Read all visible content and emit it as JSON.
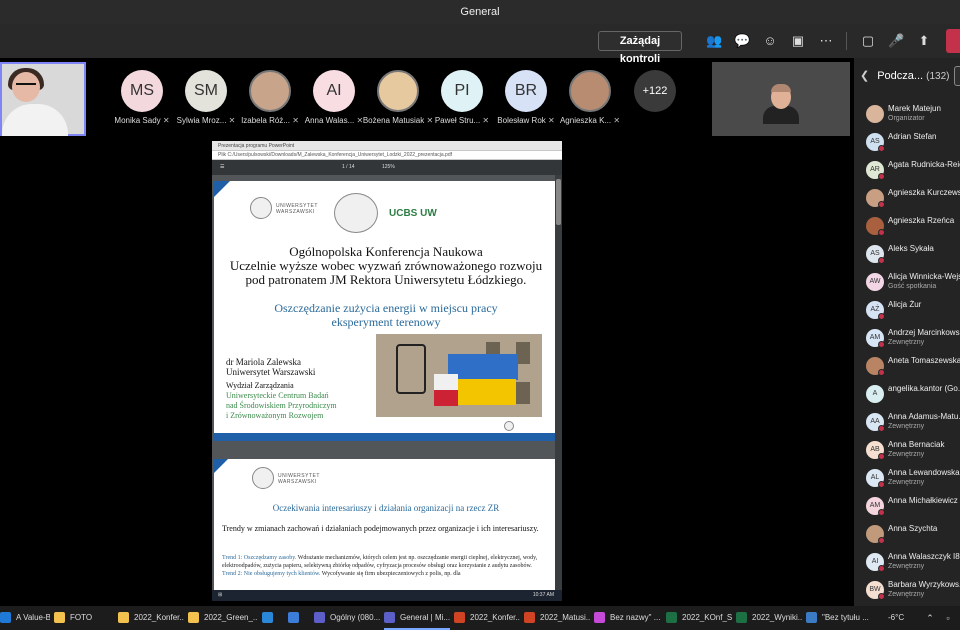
{
  "window": {
    "title": "General"
  },
  "toolbar": {
    "request_control_label": "Zażądaj kontroli",
    "icons": [
      "people-icon",
      "chat-icon",
      "reactions-icon",
      "rooms-icon",
      "more-icon",
      "camera-off-icon",
      "mic-off-icon",
      "share-icon",
      "leave-icon"
    ]
  },
  "participants": [
    {
      "initials": "MS",
      "name": "Monika Sady",
      "color": "#f3d9dd"
    },
    {
      "initials": "SM",
      "name": "Sylwia Mroz...",
      "color": "#e3e3dc"
    },
    {
      "initials": "",
      "name": "Izabela Róż...",
      "color": "#c8a48a",
      "photo": true
    },
    {
      "initials": "AI",
      "name": "Anna Walas...",
      "color": "#f8dde3"
    },
    {
      "initials": "",
      "name": "Bożena Matusiak",
      "color": "#e7c9a0",
      "photo": true
    },
    {
      "initials": "PI",
      "name": "Paweł Stru...",
      "color": "#dff2f5"
    },
    {
      "initials": "BR",
      "name": "Bolesław Rok",
      "color": "#d7e2f7"
    },
    {
      "initials": "",
      "name": "Agnieszka K...",
      "color": "#b88c70",
      "photo": true
    }
  ],
  "more_participants": "+122",
  "share": {
    "tab_text": "Prezentacja programu PowerPoint",
    "url_text": "Plik  C:/Users/pulsowski/Downloads/M_Zalewska_Konferencja_Uniwersytet_Lodzki_2022_prezentacja.pdf",
    "page_indicator": "1 / 14",
    "zoom": "125%",
    "slide1": {
      "university_name": "UNIWERSYTET WARSZAWSKI",
      "center_abbr": "UCBS UW",
      "title_lines": [
        "Ogólnopolska Konferencja Naukowa",
        "Uczelnie wyższe wobec wyzwań zrównoważonego rozwoju",
        "pod patronatem JM Rektora Uniwersytetu Łódzkiego."
      ],
      "subtitle_lines": [
        "Oszczędzanie zużycia energii w miejscu pracy",
        "eksperyment terenowy"
      ],
      "author_lines": [
        "dr Mariola Zalewska",
        "Uniwersytet Warszawski"
      ],
      "department": "Wydział Zarządzania",
      "center_lines": [
        "Uniwersyteckie Centrum Badań",
        "nad Środowiskiem Przyrodniczym",
        "i Zrównoważonym Rozwojem"
      ]
    },
    "slide2": {
      "university_name": "UNIWERSYTET WARSZAWSKI",
      "title": "Oczekiwania interesariuszy i działania organizacji na rzecz ZR",
      "trend_intro": "Trendy w zmianach zachowań i działaniach podejmowanych przez organizacje i ich interesariuszy.",
      "trend1_label": "Trend 1: Oszczędzamy zasoby.",
      "trend1_text": " Wdrażanie mechanizmów, których celem jest np. oszczędzanie energii cieplnej, elektrycznej, wody, elektroodpadów, zużycia papieru, selektywną zbiórkę odpadów, cyfryzacja procesów obsługi oraz korzystanie z audytu zasobów.",
      "trend2_label": "Trend 2: Nie obsługujemy tych klientów.",
      "trend2_text": " Wycofywanie się firm ubezpieczeniowych z polis, np. dla"
    },
    "taskbar_time": "10:37 AM"
  },
  "sidebar": {
    "title": "Podcza...",
    "count": "(132)",
    "button": "Wy",
    "people": [
      {
        "name": "Marek Matejun",
        "role": "Organizator",
        "initials": "",
        "color": "#d9b59b",
        "status": "none"
      },
      {
        "name": "Adrian Stefan",
        "role": "",
        "initials": "AS",
        "color": "#cfe0f0",
        "status": "red"
      },
      {
        "name": "Agata Rudnicka-Reich",
        "role": "",
        "initials": "AR",
        "color": "#dfe8d5",
        "status": "red"
      },
      {
        "name": "Agnieszka Kurczewska",
        "role": "",
        "initials": "",
        "color": "#c89f82",
        "status": "red"
      },
      {
        "name": "Agnieszka Rzeńca",
        "role": "",
        "initials": "",
        "color": "#a8603f",
        "status": "red"
      },
      {
        "name": "Aleks Sykała",
        "role": "",
        "initials": "AS",
        "color": "#dde6ee",
        "status": "red"
      },
      {
        "name": "Alicja Winnicka-Wejs",
        "role": "Gość spotkania",
        "initials": "AW",
        "color": "#f3d6e6",
        "status": "none"
      },
      {
        "name": "Alicja Żur",
        "role": "",
        "initials": "AŻ",
        "color": "#d5e3f5",
        "status": "red"
      },
      {
        "name": "Andrzej Marcinkowski",
        "role": "Zewnętrzny",
        "initials": "AM",
        "color": "#d7e6f7",
        "status": "red"
      },
      {
        "name": "Aneta Tomaszewska",
        "role": "",
        "initials": "",
        "color": "#b88464",
        "status": "red"
      },
      {
        "name": "angelika.kantor (Go...",
        "role": "",
        "initials": "A",
        "color": "#d9eef1",
        "status": "none"
      },
      {
        "name": "Anna Adamus-Matu...",
        "role": "Zewnętrzny",
        "initials": "AA",
        "color": "#d9e6f4",
        "status": "red"
      },
      {
        "name": "Anna Bernaciak",
        "role": "Zewnętrzny",
        "initials": "AB",
        "color": "#f6dfd0",
        "status": "red"
      },
      {
        "name": "Anna Lewandowska",
        "role": "Zewnętrzny",
        "initials": "AL",
        "color": "#dbe7f3",
        "status": "red"
      },
      {
        "name": "Anna Michałkiewicz",
        "role": "",
        "initials": "AM",
        "color": "#f4d5dd",
        "status": "red"
      },
      {
        "name": "Anna Szychta",
        "role": "",
        "initials": "",
        "color": "#c09a7a",
        "status": "red"
      },
      {
        "name": "Anna Walaszczyk I8",
        "role": "Zewnętrzny",
        "initials": "AI",
        "color": "#dfe9f4",
        "status": "red"
      },
      {
        "name": "Barbara Wyrzykows...",
        "role": "Zewnętrzny",
        "initials": "BW",
        "color": "#f5dfd0",
        "status": "red"
      }
    ]
  },
  "taskbar": {
    "items": [
      {
        "label": "A Value-Beli...",
        "icon": "#1e7ad6",
        "active": false
      },
      {
        "label": "FOTO",
        "icon": "#f2c14e",
        "active": false
      },
      {
        "label": "2022_Konfer...",
        "icon": "#f2c14e",
        "active": false
      },
      {
        "label": "2022_Green_...",
        "icon": "#f2c14e",
        "active": false
      },
      {
        "label": "",
        "icon": "#2b88d8",
        "active": false
      },
      {
        "label": "",
        "icon": "#3c7dd9",
        "active": false
      },
      {
        "label": "Ogólny (080...",
        "icon": "#5b5fc7",
        "active": false
      },
      {
        "label": "General | Mi...",
        "icon": "#5b5fc7",
        "active": true
      },
      {
        "label": "2022_Konfer...",
        "icon": "#d04423",
        "active": false
      },
      {
        "label": "2022_Matusi...",
        "icon": "#d04423",
        "active": false
      },
      {
        "label": "Bez nazwy\" ...",
        "icon": "#c64ad8",
        "active": false
      },
      {
        "label": "2022_KOnf_S...",
        "icon": "#1d7044",
        "active": false
      },
      {
        "label": "2022_Wyniki...",
        "icon": "#1d7044",
        "active": false
      },
      {
        "label": "\"Bez tytułu ...",
        "icon": "#3b7ac4",
        "active": false
      }
    ],
    "weather": "-6°C"
  }
}
